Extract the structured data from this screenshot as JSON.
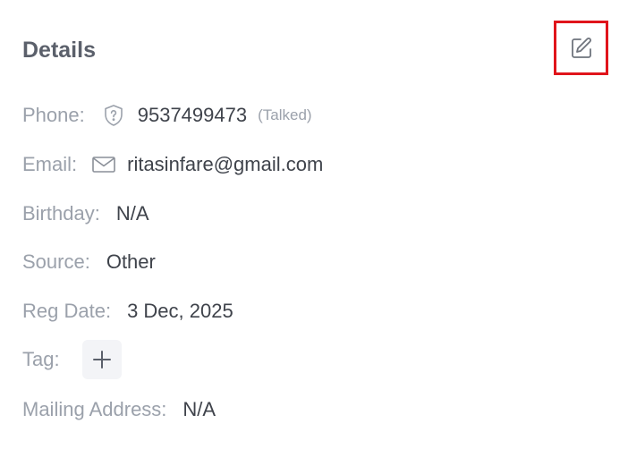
{
  "details": {
    "title": "Details",
    "edit_icon": "edit-icon"
  },
  "fields": {
    "phone": {
      "label": "Phone:",
      "icon": "shield-question-icon",
      "value": "9537499473",
      "status": "(Talked)"
    },
    "email": {
      "label": "Email:",
      "icon": "envelope-icon",
      "value": "ritasinfare@gmail.com"
    },
    "birthday": {
      "label": "Birthday:",
      "value": "N/A"
    },
    "source": {
      "label": "Source:",
      "value": "Other"
    },
    "reg_date": {
      "label": "Reg Date:",
      "value": "3 Dec, 2025"
    },
    "tag": {
      "label": "Tag:",
      "add_icon": "plus-icon"
    },
    "mailing_address": {
      "label": "Mailing Address:",
      "value": "N/A"
    }
  },
  "colors": {
    "highlight_border": "#e0141b",
    "label": "#9ba1ab",
    "value": "#3f434b"
  }
}
